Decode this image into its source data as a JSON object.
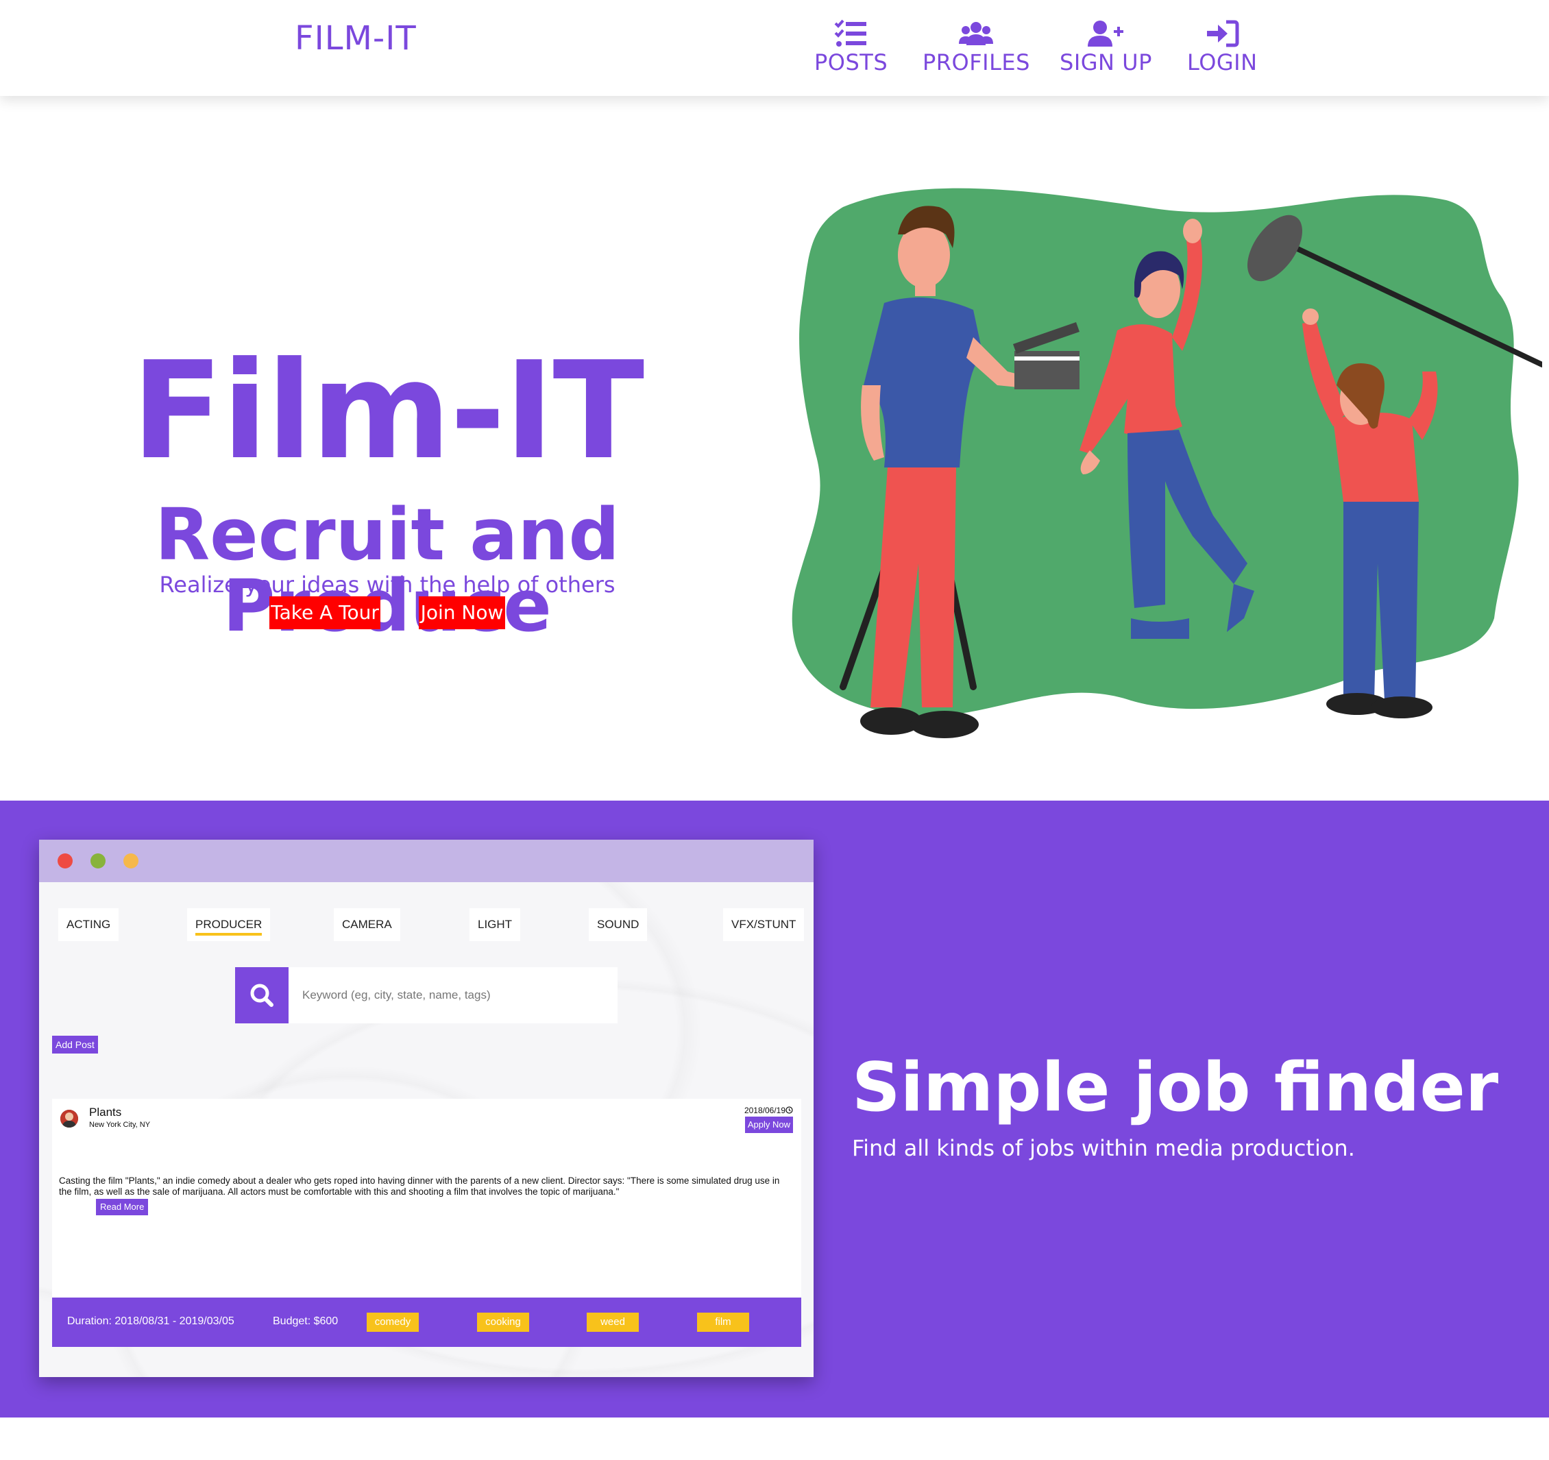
{
  "navbar": {
    "brand": "FILM-IT",
    "items": [
      {
        "label": "POSTS",
        "icon": "tasks-list-icon"
      },
      {
        "label": "PROFILES",
        "icon": "users-icon"
      },
      {
        "label": "SIGN UP",
        "icon": "user-plus-icon"
      },
      {
        "label": "LOGIN",
        "icon": "sign-in-icon"
      }
    ]
  },
  "hero": {
    "title": "Film-IT",
    "subtitle": "Recruit and Produce",
    "tagline": "Realize your ideas with the help of others",
    "tour_label": "Take A Tour",
    "join_label": "Join Now"
  },
  "feature": {
    "title": "Simple job finder",
    "subtitle": "Find all kinds of jobs within media production."
  },
  "preview": {
    "categories": [
      "ACTING",
      "PRODUCER",
      "CAMERA",
      "LIGHT",
      "SOUND",
      "VFX/STUNT"
    ],
    "active_category": "PRODUCER",
    "search_placeholder": "Keyword (eg, city, state, name, tags)",
    "add_post_label": "Add Post",
    "post": {
      "title": "Plants",
      "location": "New York City, NY",
      "date": "2018/06/19",
      "apply_label": "Apply Now",
      "description": "Casting the film \"Plants,\" an indie comedy about a dealer who gets roped into having dinner with the parents of a new client. Director says: \"There is some simulated drug use in the film, as well as the sale of marijuana. All actors must be comfortable with this and shooting a film that involves the topic of marijuana.\"",
      "read_more_label": "Read More",
      "duration": "Duration: 2018/08/31 - 2019/03/05",
      "budget": "Budget: $600",
      "tags": [
        "comedy",
        "cooking",
        "weed",
        "film"
      ]
    }
  },
  "colors": {
    "accent": "#7b48dd",
    "cta": "#ff0000",
    "tag": "#f8c21b",
    "window_bar": "#c4b5e6"
  }
}
